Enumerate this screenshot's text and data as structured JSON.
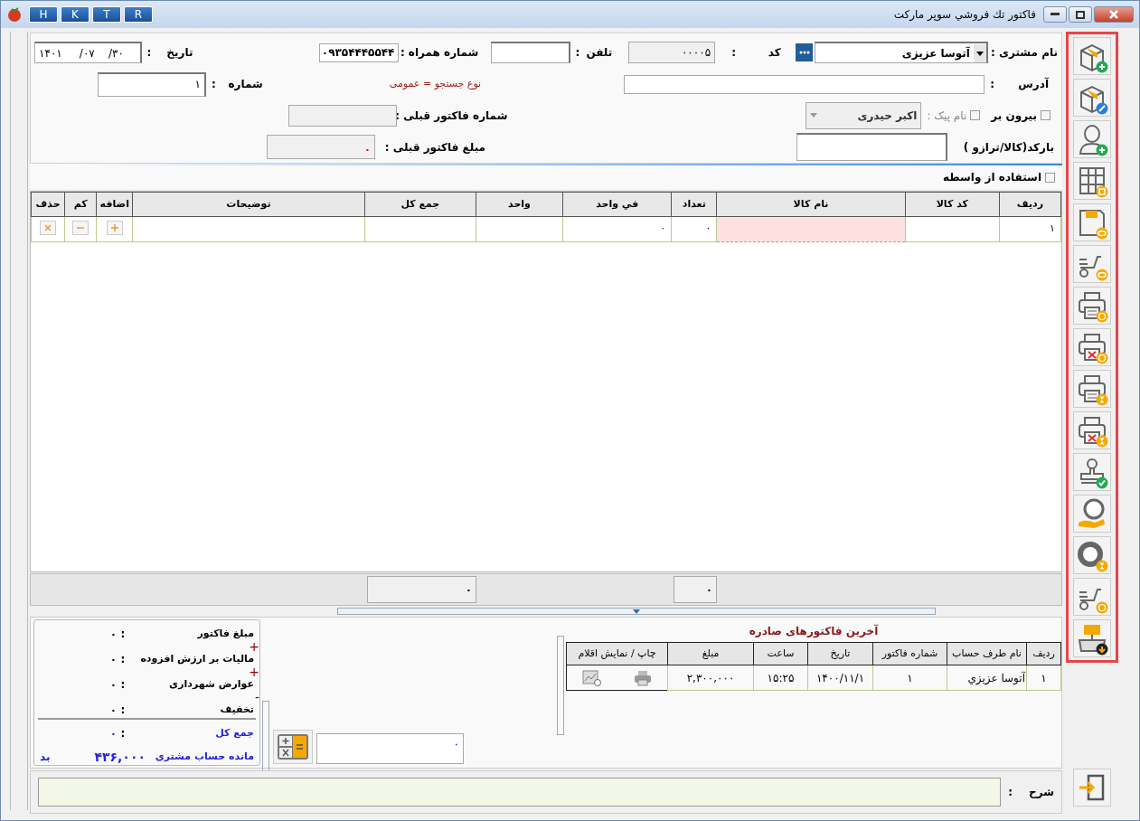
{
  "window": {
    "title": "فاکتور تك فروشي سوپر ماركت",
    "quick_buttons": [
      "R",
      "T",
      "K",
      "H"
    ]
  },
  "header": {
    "customer": {
      "label": "نام مشتری :",
      "value": "آتوسا عزیزی"
    },
    "code": {
      "label": "کد",
      "separator": ":",
      "value": "۰۰۰۰۵"
    },
    "phone": {
      "label": "تلفن",
      "separator": ":"
    },
    "mobile": {
      "label": "شماره همراه :",
      "value": "۰۹۳۵۴۴۴۵۵۴۴"
    },
    "date": {
      "label": "تاریخ",
      "separator": ":",
      "value": "۱۴۰۱     /۰۷    /۳۰"
    },
    "address": {
      "label": "آدرس",
      "separator": ":"
    },
    "search_type": "نوع جستجو = عمومی",
    "number": {
      "label": "شماره",
      "separator": ":",
      "value": "۱"
    },
    "takeaway": {
      "label": "بیرون بر",
      "checked": false
    },
    "courier": {
      "label": "نام پیک :",
      "checked": false,
      "disabled": true,
      "value": "اکبر حیدری"
    },
    "prev_invoice_number": {
      "label": "شماره فاکتور قبلی :"
    },
    "barcode": {
      "label": "بارکد(کالا/ترازو )"
    },
    "prev_invoice_amount": {
      "label": "مبلغ فاکتور قبلی :",
      "value": "۰"
    },
    "intermediary": {
      "label": "استفاده از واسطه",
      "checked": false
    }
  },
  "items": {
    "columns": [
      "ردیف",
      "کد کالا",
      "نام کالا",
      "تعداد",
      "في واحد",
      "واحد",
      "جمع کل",
      "توضیحات",
      "اضافه",
      "کم",
      "حذف"
    ],
    "rows": [
      {
        "row": "۱",
        "quantity": "۰",
        "unit_price": "۰",
        "editing": true
      }
    ]
  },
  "totals": {
    "quantity": "۰",
    "total": "۰"
  },
  "summary": {
    "rows": [
      {
        "label": "مبلغ فاکتور",
        "separator": ":",
        "value": "۰",
        "operator": "+"
      },
      {
        "label": "مالیات بر ارزش افزوده",
        "separator": ":",
        "value": "۰",
        "operator": "+"
      },
      {
        "label": "عوارض شهرداری",
        "separator": ":",
        "value": "۰",
        "operator": "-"
      },
      {
        "label": "تخفیف",
        "separator": ":",
        "value": "۰"
      }
    ],
    "grand_total": {
      "label": "جمع کل",
      "separator": ":",
      "value": "۰"
    },
    "balance": {
      "label": "مانده حساب مشتری",
      "value": "۴۳۶,۰۰۰",
      "status": "بد"
    }
  },
  "calculator_field": {
    "value": "۰"
  },
  "recent_invoices": {
    "title": "آخرین فاکتورهای صادره",
    "columns": [
      "ردیف",
      "نام طرف حساب",
      "شماره فاکتور",
      "تاریخ",
      "ساعت",
      "مبلغ",
      "چاپ / نمایش اقلام"
    ],
    "rows": [
      {
        "row": "۱",
        "account": "آتوسا عزيزي",
        "number": "۱",
        "date": "۱۴۰۰/۱۱/۱",
        "time": "۱۵:۲۵",
        "amount": "۲,۳۰۰,۰۰۰"
      }
    ]
  },
  "description": {
    "label": "شرح",
    "separator": ":"
  }
}
